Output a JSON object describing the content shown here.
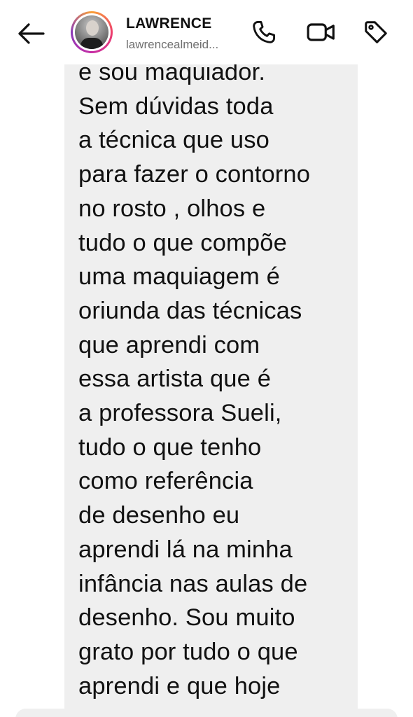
{
  "header": {
    "back_icon": "arrow-left-icon",
    "contact_name": "LAWRENCE",
    "contact_username": "lawrencealmeid...",
    "phone_icon": "phone-icon",
    "video_icon": "video-camera-icon",
    "tag_icon": "tag-icon",
    "avatar_ring_colors": [
      "#f9a23a",
      "#ee3d6b",
      "#c62ea6",
      "#8a3ab9"
    ]
  },
  "message": {
    "text": "e sou maquiador.\nSem dúvidas toda\na técnica que uso\npara fazer o contorno\nno rosto , olhos e\ntudo o que compõe\numa maquiagem é\noriunda das técnicas\nque aprendi com\nessa artista que é\na professora Sueli,\ntudo o que tenho\ncomo referência\nde desenho eu\naprendi lá na minha\ninfância nas aulas de\ndesenho. Sou muito\ngrato por tudo o que\naprendi e que hoje",
    "bubble_color": "#efefef"
  }
}
